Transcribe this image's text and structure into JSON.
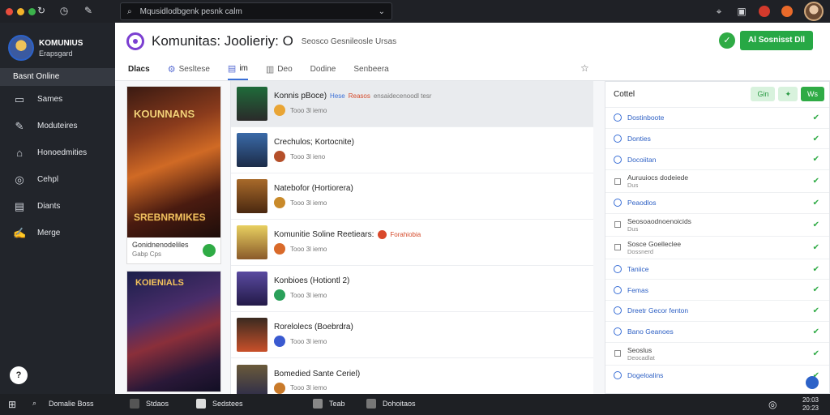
{
  "topbar": {
    "search_text": "Mqusidlodbgenk pesnk calm",
    "colors": {
      "close": "#e84d3d",
      "minimize": "#f3b32a",
      "maximize": "#3bb24b"
    }
  },
  "sidebar": {
    "profile_name": "KOMUNIUS",
    "profile_sub": "Erapsgard",
    "active_label": "Basnt Online",
    "items": [
      {
        "label": "Sames",
        "icon": "monitor-icon"
      },
      {
        "label": "Moduteires",
        "icon": "pencil-icon"
      },
      {
        "label": "Honoedmities",
        "icon": "home-icon"
      },
      {
        "label": "Cehpl",
        "icon": "globe-icon"
      },
      {
        "label": "Diants",
        "icon": "grid-icon"
      },
      {
        "label": "Merge",
        "icon": "edit-icon"
      }
    ],
    "help_label": "?"
  },
  "header": {
    "title": "Komunitas: Joolieriy: O",
    "subtitle": "Seosco Gesnileosle Ursas",
    "button_label": "Al Sosnisst Dll"
  },
  "tabs": [
    {
      "label": "Dlacs",
      "bold": true
    },
    {
      "label": "Sesltese"
    },
    {
      "label": "im",
      "active": true
    },
    {
      "label": "Deo"
    },
    {
      "label": "Dodine"
    },
    {
      "label": "Senbeera"
    }
  ],
  "cards": [
    {
      "art_title": "KOUNNANS",
      "art_bottom": "SREBNRMIKES",
      "line1": "Gonidnenodeliles",
      "line2": "Gabp Cps"
    },
    {
      "art_title": "KOIENIALS"
    }
  ],
  "list": [
    {
      "title": "Konnis pBoce)",
      "tag": "Hese",
      "red": "Reasos",
      "gray": "ensaidecenoodl tesr",
      "sub": "Tooo 3l iemo"
    },
    {
      "title": "Crechulos; Kortocnite)",
      "sub": "Tooo 3l ieno"
    },
    {
      "title": "Natebofor (Hortiorera)",
      "sub": "Tooo 3l iemo"
    },
    {
      "title": "Komunitie Soline Reetiears:",
      "red_after": "Forahiobia",
      "sub": "Tooo 3l iemo"
    },
    {
      "title": "Konbioes (Hotiontl 2)",
      "sub": "Tooo 3l iemo"
    },
    {
      "title": "Rorelolecs (Boebrdra)",
      "sub": "Tooo 3l iemo"
    },
    {
      "title": "Bomedied Sante Ceriel)",
      "sub": "Tooo 3l iemo"
    }
  ],
  "panel": {
    "title": "Cottel",
    "btn1": "Gin",
    "btn2": "Ws",
    "rows": [
      {
        "type": "circle",
        "label": "Dostinboote"
      },
      {
        "type": "circle",
        "label": "Donties"
      },
      {
        "type": "circle",
        "label": "Docoiitan"
      },
      {
        "type": "square",
        "label": "Auruuiocs dodeiede",
        "sub": "Dus"
      },
      {
        "type": "circle",
        "label": "Peaodlos"
      },
      {
        "type": "square",
        "label": "Seosoaodnoenoicids",
        "sub": "Dus"
      },
      {
        "type": "square",
        "label": "Sosce Goelleclee",
        "sub": "Dossnerd"
      },
      {
        "type": "circle",
        "label": "Taniice"
      },
      {
        "type": "circle",
        "label": "Femas"
      },
      {
        "type": "circle",
        "label": "Dreetr Gecor fenton"
      },
      {
        "type": "circle",
        "label": "Bano Geanoes"
      },
      {
        "type": "square",
        "label": "Seoslus",
        "sub": "Deocadlat"
      },
      {
        "type": "circle",
        "label": "Dogeloalins"
      }
    ]
  },
  "taskbar": {
    "search": "Domalie Boss",
    "items": [
      "Stdaos",
      "Sedstees",
      "Teab",
      "Dohoitaos"
    ],
    "time": "20:03",
    "date": "20:23"
  }
}
